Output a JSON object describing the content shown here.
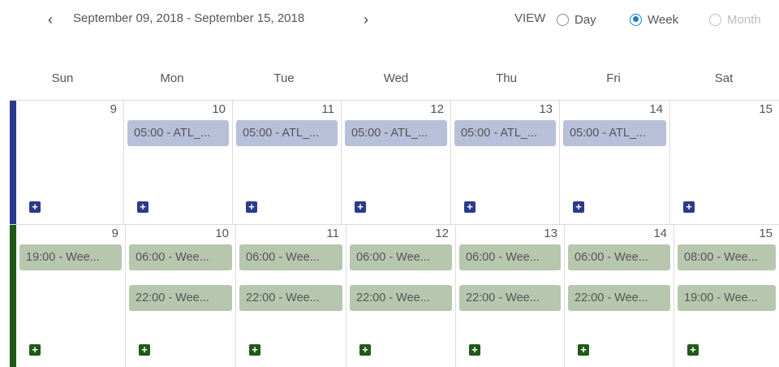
{
  "header": {
    "prev_icon": "‹",
    "next_icon": "›",
    "date_range": "September 09, 2018 - September 15, 2018",
    "view_label": "VIEW",
    "views": [
      {
        "label": "Day",
        "state": "unselected"
      },
      {
        "label": "Week",
        "state": "selected"
      },
      {
        "label": "Month",
        "state": "disabled"
      }
    ]
  },
  "days": [
    "Sun",
    "Mon",
    "Tue",
    "Wed",
    "Thu",
    "Fri",
    "Sat"
  ],
  "rows": [
    {
      "color": "#2a3a8e",
      "event_color": "#b8bfd9",
      "dates": [
        "9",
        "10",
        "11",
        "12",
        "13",
        "14",
        "15"
      ],
      "events": [
        [],
        [
          "05:00 - ATL_..."
        ],
        [
          "05:00 - ATL_..."
        ],
        [
          "05:00 - ATL_..."
        ],
        [
          "05:00 - ATL_..."
        ],
        [
          "05:00 - ATL_..."
        ],
        []
      ],
      "add_label": "+"
    },
    {
      "color": "#1f5a17",
      "event_color": "#b7c7ae",
      "dates": [
        "9",
        "10",
        "11",
        "12",
        "13",
        "14",
        "15"
      ],
      "events": [
        [
          "19:00 - Wee..."
        ],
        [
          "06:00 - Wee...",
          "22:00 - Wee..."
        ],
        [
          "06:00 - Wee...",
          "22:00 - Wee..."
        ],
        [
          "06:00 - Wee...",
          "22:00 - Wee..."
        ],
        [
          "06:00 - Wee...",
          "22:00 - Wee..."
        ],
        [
          "06:00 - Wee...",
          "22:00 - Wee..."
        ],
        [
          "08:00 - Wee...",
          "19:00 - Wee..."
        ]
      ],
      "add_label": "+"
    }
  ]
}
